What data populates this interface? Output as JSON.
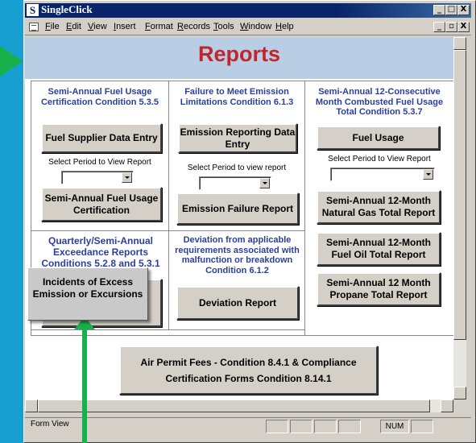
{
  "app": {
    "logo_letter": "S",
    "title": "SingleClick",
    "caption_buttons": [
      "_",
      "□",
      "X"
    ],
    "doc_caption_buttons": [
      "_",
      "▫",
      "X"
    ]
  },
  "menu": [
    "File",
    "Edit",
    "View",
    "Insert",
    "Format",
    "Records",
    "Tools",
    "Window",
    "Help"
  ],
  "form": {
    "title": "Reports",
    "col1": {
      "title": "Semi-Annual Fuel Usage Certification Condition 5.3.5",
      "btn_supplier": "Fuel Supplier Data Entry",
      "select_label": "Select Period to View Report",
      "select_value": "",
      "btn_cert": "Semi-Annual Fuel Usage Certification"
    },
    "col2": {
      "title": "Failure to Meet Emission Limitations Condition 6.1.3",
      "btn_entry": "Emission Reporting Data Entry",
      "select_label": "Select Period to view report",
      "select_value": "",
      "btn_failure": "Emission Failure Report"
    },
    "col3": {
      "title": "Semi-Annual 12-Consecutive Month Combusted Fuel Usage Total Condition 5.3.7",
      "btn_fuel": "Fuel Usage",
      "select_label": "Select Period to View Report",
      "select_value": "",
      "btn_gas": "Semi-Annual 12-Month Natural Gas Total Report",
      "btn_oil": "Semi-Annual 12-Month Fuel Oil Total Report",
      "btn_propane": "Semi-Annual 12 Month Propane Total Report"
    },
    "row2col1": {
      "title": "Quarterly/Semi-Annual Exceedance Reports Conditions 5.2.8 and 5.3.1"
    },
    "row2col2": {
      "title": "Deviation from applicable requirements associated with malfunction or breakdown Condition 6.1.2",
      "btn_deviation": "Deviation Report"
    },
    "btn_air_permit": "Air Permit Fees - Condition 8.4.1 & Compliance Certification Forms Condition 8.14.1"
  },
  "tooltip": "Incidents of Excess Emission or Excursions",
  "status": {
    "text": "Form View",
    "num": "NUM"
  },
  "colors": {
    "title_red": "#c0272d",
    "section_blue": "#2b3f9e",
    "header_band": "#b9cde5",
    "arrow_green": "#18b04a",
    "background": "#169fd0"
  }
}
